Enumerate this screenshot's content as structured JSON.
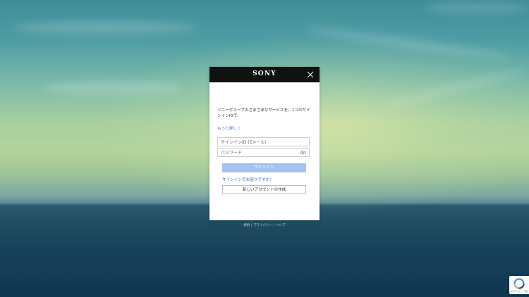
{
  "brand": "SONY",
  "modal": {
    "intro_text": "ソニーグループのさまざまなサービスを、1つのサインインIDで。",
    "learn_more": "もっと詳しく",
    "signin_id_placeholder": "サインインID (Eメール)",
    "password_placeholder": "パスワード",
    "signin_button": "サインイン",
    "trouble_link": "サインインでお困りですか？",
    "create_account_button": "新しいアカウントの作成"
  },
  "footer": {
    "links": [
      "規約",
      "プライバシー",
      "ヘルプ"
    ],
    "separator": " | "
  },
  "recaptcha": {
    "text": "プライバシー - 利用規約"
  },
  "colors": {
    "header": "#111111",
    "primary_button": "#a3c2ef",
    "link": "#3a62c8"
  }
}
